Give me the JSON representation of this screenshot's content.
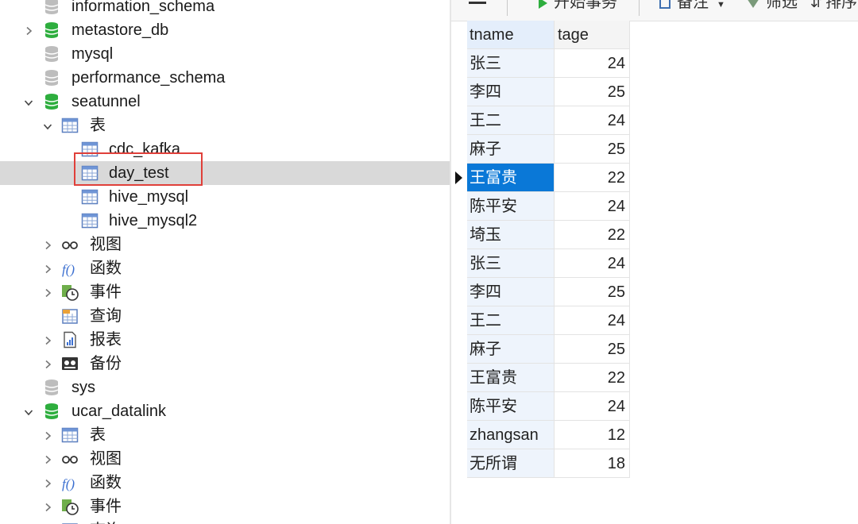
{
  "tree": [
    {
      "label": "information_schema",
      "icon": "database-icon",
      "gray": true,
      "level": 0,
      "chev": "none"
    },
    {
      "label": "metastore_db",
      "icon": "database-icon",
      "gray": false,
      "level": 0,
      "chev": "right"
    },
    {
      "label": "mysql",
      "icon": "database-icon",
      "gray": true,
      "level": 0,
      "chev": "none"
    },
    {
      "label": "performance_schema",
      "icon": "database-icon",
      "gray": true,
      "level": 0,
      "chev": "none"
    },
    {
      "label": "seatunnel",
      "icon": "database-icon",
      "gray": false,
      "level": 0,
      "chev": "down"
    },
    {
      "label": "表",
      "icon": "table-icon",
      "level": 1,
      "chev": "down"
    },
    {
      "label": "cdc_kafka",
      "icon": "table-icon",
      "level": 2,
      "chev": "none"
    },
    {
      "label": "day_test",
      "icon": "table-icon",
      "level": 2,
      "chev": "none",
      "selected": true
    },
    {
      "label": "hive_mysql",
      "icon": "table-icon",
      "level": 2,
      "chev": "none"
    },
    {
      "label": "hive_mysql2",
      "icon": "table-icon",
      "level": 2,
      "chev": "none"
    },
    {
      "label": "视图",
      "icon": "view-icon",
      "level": 1,
      "chev": "right"
    },
    {
      "label": "函数",
      "icon": "function-icon",
      "level": 1,
      "chev": "right"
    },
    {
      "label": "事件",
      "icon": "event-icon",
      "level": 1,
      "chev": "right"
    },
    {
      "label": "查询",
      "icon": "query-icon",
      "level": 1,
      "chev": "none"
    },
    {
      "label": "报表",
      "icon": "report-icon",
      "level": 1,
      "chev": "right"
    },
    {
      "label": "备份",
      "icon": "backup-icon",
      "level": 1,
      "chev": "right"
    },
    {
      "label": "sys",
      "icon": "database-icon",
      "gray": true,
      "level": 0,
      "chev": "none"
    },
    {
      "label": "ucar_datalink",
      "icon": "database-icon",
      "gray": false,
      "level": 0,
      "chev": "down"
    },
    {
      "label": "表",
      "icon": "table-icon",
      "level": 1,
      "chev": "right"
    },
    {
      "label": "视图",
      "icon": "view-icon",
      "level": 1,
      "chev": "right"
    },
    {
      "label": "函数",
      "icon": "function-icon",
      "level": 1,
      "chev": "right"
    },
    {
      "label": "事件",
      "icon": "event-icon",
      "level": 1,
      "chev": "right"
    },
    {
      "label": "查询",
      "icon": "query-icon",
      "level": 1,
      "chev": "right"
    }
  ],
  "toolbar": {
    "begin_transaction_label": "开始事务",
    "memo_label": "备注",
    "filter_label": "筛选",
    "sort_label": "排序"
  },
  "grid": {
    "columns": [
      "tname",
      "tage"
    ],
    "rows": [
      {
        "tname": "张三",
        "tage": "24"
      },
      {
        "tname": "李四",
        "tage": "25"
      },
      {
        "tname": "王二",
        "tage": "24"
      },
      {
        "tname": "麻子",
        "tage": "25"
      },
      {
        "tname": "王富贵",
        "tage": "22",
        "selected": true
      },
      {
        "tname": "陈平安",
        "tage": "24"
      },
      {
        "tname": "埼玉",
        "tage": "22"
      },
      {
        "tname": "张三",
        "tage": "24"
      },
      {
        "tname": "李四",
        "tage": "25"
      },
      {
        "tname": "王二",
        "tage": "24"
      },
      {
        "tname": "麻子",
        "tage": "25"
      },
      {
        "tname": "王富贵",
        "tage": "22"
      },
      {
        "tname": "陈平安",
        "tage": "24"
      },
      {
        "tname": "zhangsan",
        "tage": "12"
      },
      {
        "tname": "无所谓",
        "tage": "18"
      }
    ]
  },
  "colors": {
    "db_active": "#2eae3e",
    "db_inactive": "#bdbdbd",
    "selection": "#0a78d7",
    "highlight_box": "#e0403a"
  }
}
